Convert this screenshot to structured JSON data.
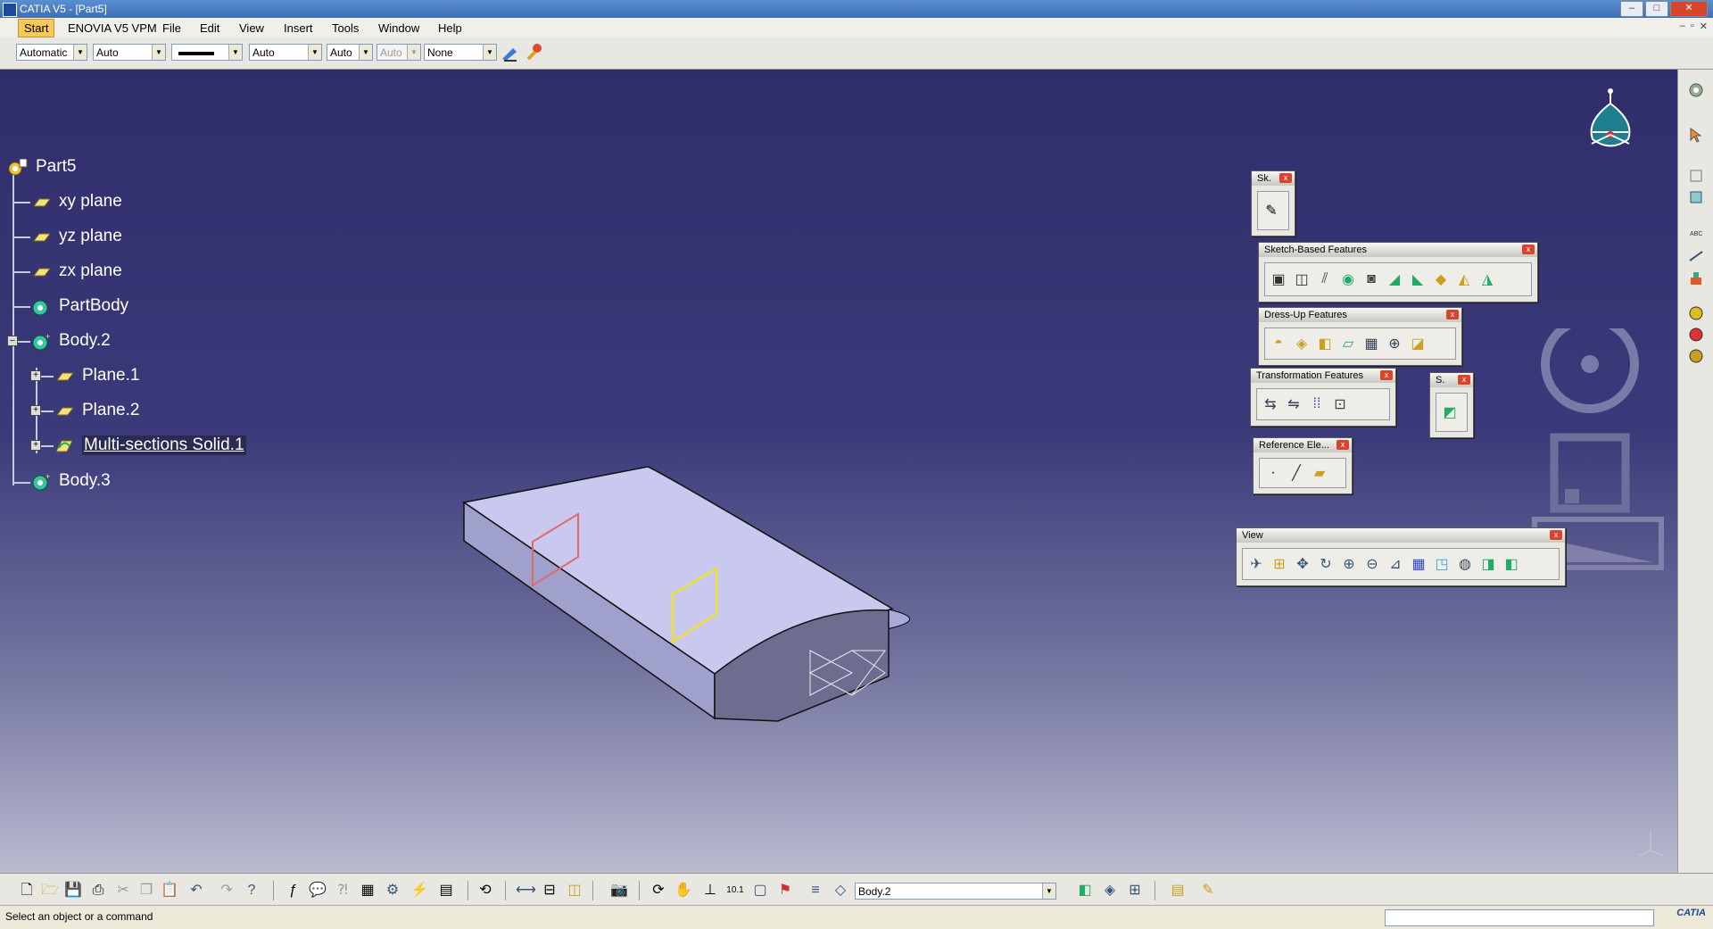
{
  "window": {
    "title": "CATIA V5 - [Part5]",
    "minimize": "–",
    "maximize": "□",
    "close": "✕"
  },
  "menu": {
    "items": [
      "Start",
      "ENOVIA V5 VPM",
      "File",
      "Edit",
      "View",
      "Insert",
      "Tools",
      "Window",
      "Help"
    ],
    "mdi": [
      "–",
      "▫",
      "✕"
    ]
  },
  "properties": {
    "color": "Automatic",
    "transparency": "Auto",
    "line_weight": "7",
    "line_type": "Auto",
    "point_type": "Auto",
    "layer_disabled": "Auto",
    "render_style": "None"
  },
  "tree": {
    "root": "Part5",
    "nodes": [
      "xy plane",
      "yz plane",
      "zx plane",
      "PartBody",
      "Body.2",
      "Plane.1",
      "Plane.2",
      "Multi-sections Solid.1",
      "Body.3"
    ],
    "expanders": [
      "–",
      "+",
      "+",
      "+"
    ]
  },
  "toolbars": {
    "sketcher": "Sk.",
    "sketch_based": "Sketch-Based Features",
    "dress_up": "Dress-Up Features",
    "transformation": "Transformation Features",
    "surface": "S.",
    "reference": "Reference Ele...",
    "view": "View",
    "close": "x"
  },
  "bottom": {
    "current_body": "Body.2"
  },
  "status": {
    "message": "Select an object or a command",
    "brand": "CATIA"
  },
  "colors": {
    "viewport_top": "#302d6b",
    "viewport_bottom": "#b9b9cf",
    "tree_text": "#ffffff",
    "solid_face": "#c9c9ef"
  }
}
